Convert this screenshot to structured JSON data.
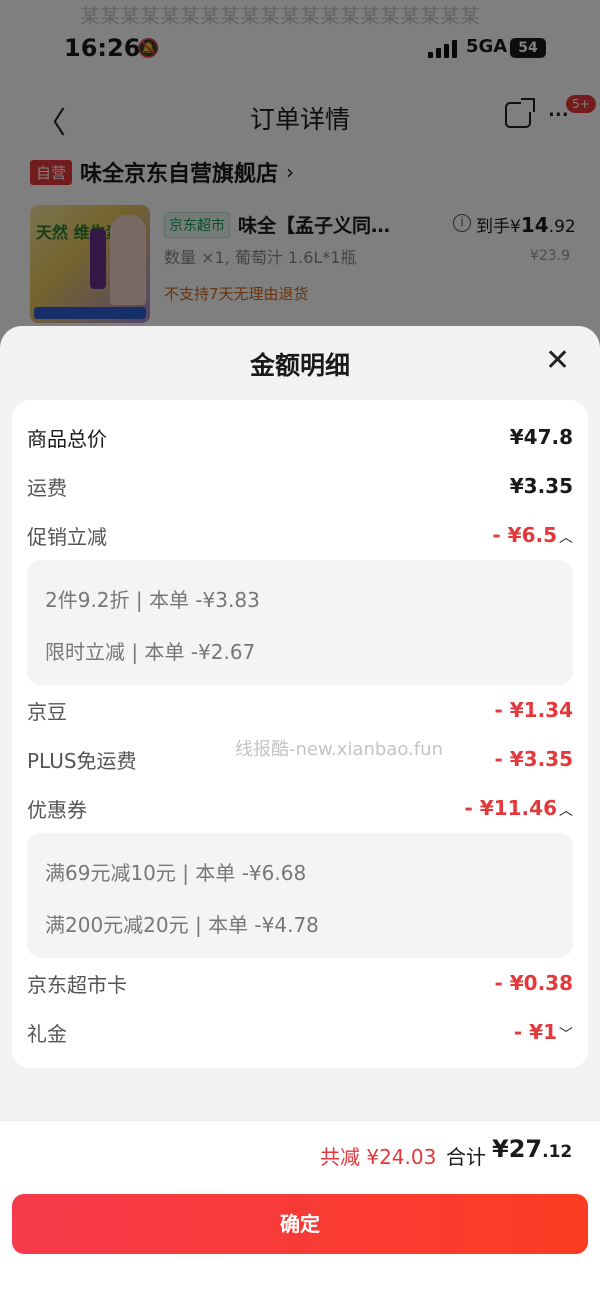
{
  "status_bar": {
    "time": "16:26",
    "network": "5GA",
    "battery": "54"
  },
  "background_ghost_text": "某某某某某某某某某某某某某某某某某某某某",
  "navbar": {
    "back": "〈",
    "title": "订单详情",
    "badge": "5+"
  },
  "store": {
    "tag": "自营",
    "name": "味全京东自营旗舰店",
    "arrow": "›"
  },
  "product": {
    "thumb_text": "天然 维生素",
    "category": "京东超市",
    "name": "味全【孟子义同…",
    "spec": "数量 ×1, 葡萄汁 1.6L*1瓶",
    "notice": "不支持7天无理由退货",
    "paid_label": "到手¥",
    "paid_int": "14",
    "paid_dec": ".92",
    "original": "¥23.9"
  },
  "sheet": {
    "title": "金额明细",
    "close": "✕",
    "rows": [
      {
        "label": "商品总价",
        "value": "¥47.8"
      },
      {
        "label": "运费",
        "value": "¥3.35"
      },
      {
        "label": "促销立减",
        "value": "- ¥6.5"
      },
      {
        "label": "京豆",
        "value": "- ¥1.34"
      },
      {
        "label": "PLUS免运费",
        "value": "- ¥3.35"
      },
      {
        "label": "优惠券",
        "value": "- ¥11.46"
      },
      {
        "label": "京东超市卡",
        "value": "- ¥0.38"
      },
      {
        "label": "礼金",
        "value": "- ¥1"
      }
    ],
    "promo_details": [
      "2件9.2折 | 本单 -¥3.83",
      "限时立减 | 本单 -¥2.67"
    ],
    "coupon_details": [
      "满69元减10元 | 本单 -¥6.68",
      "满200元减20元 | 本单 -¥4.78"
    ],
    "watermark": "线报酷-new.xianbao.fun"
  },
  "summary": {
    "reduce": "共减 ¥24.03",
    "total_label": "合计",
    "total_int": "¥27",
    "total_dec": ".12"
  },
  "confirm_label": "确定",
  "colors": {
    "accent": "#e4393c",
    "button_start": "#f6394b",
    "button_end": "#fb3c22"
  }
}
